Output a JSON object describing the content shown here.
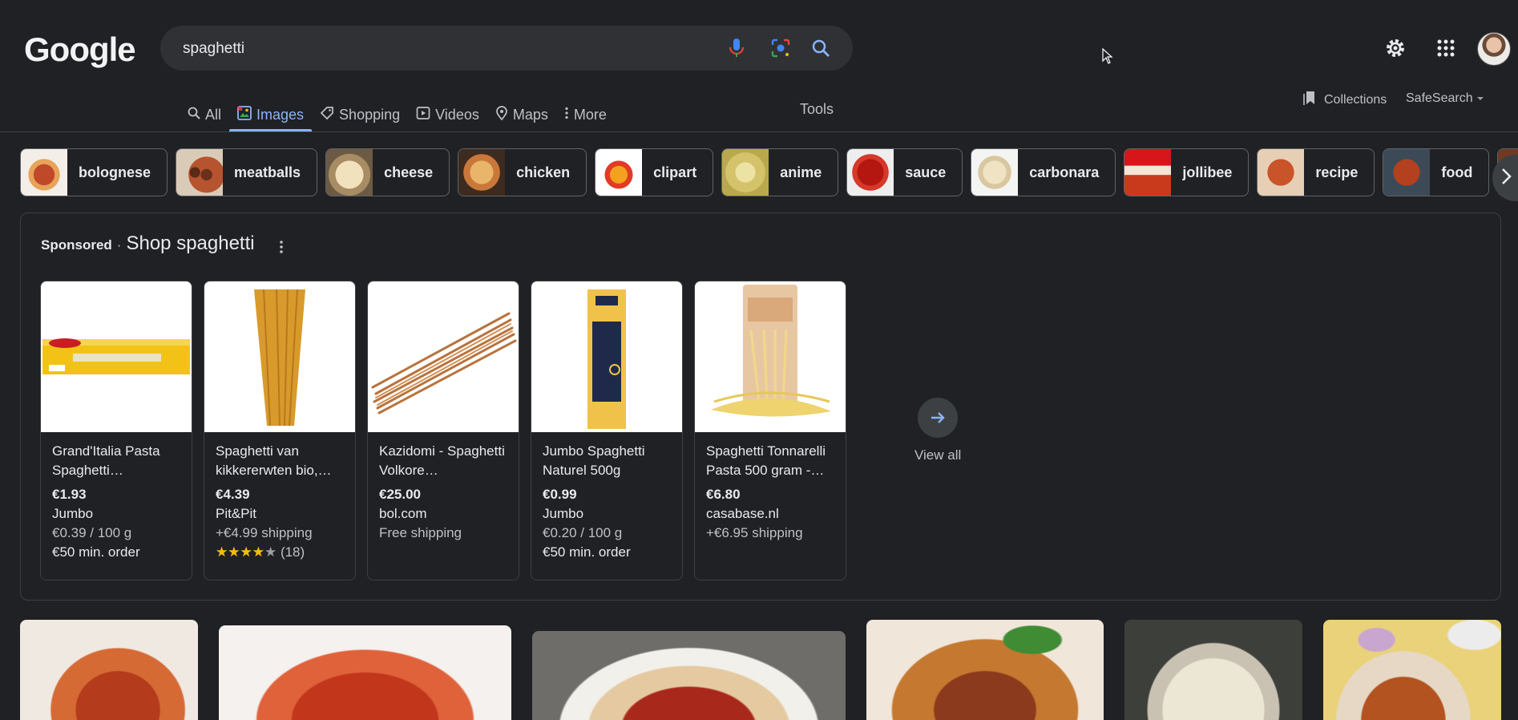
{
  "header": {
    "logo": "Google",
    "search_value": "spaghetti"
  },
  "tabs": [
    {
      "label": "All",
      "icon": "search-icon"
    },
    {
      "label": "Images",
      "icon": "image-icon"
    },
    {
      "label": "Shopping",
      "icon": "tag-icon"
    },
    {
      "label": "Videos",
      "icon": "play-icon"
    },
    {
      "label": "Maps",
      "icon": "pin-icon"
    },
    {
      "label": "More",
      "icon": "kebab-icon"
    }
  ],
  "toolbar": {
    "tools": "Tools",
    "collections": "Collections",
    "safesearch": "SafeSearch"
  },
  "chips": [
    "bolognese",
    "meatballs",
    "cheese",
    "chicken",
    "clipart",
    "anime",
    "sauce",
    "carbonara",
    "jollibee",
    "recipe",
    "food"
  ],
  "shopping": {
    "sponsored": "Sponsored",
    "separator": "·",
    "title": "Shop spaghetti",
    "view_all": "View all",
    "products": [
      {
        "title": "Grand'Italia Pasta Spaghetti…",
        "price": "€1.93",
        "store": "Jumbo",
        "line1": "€0.39 / 100 g",
        "line2": "€50 min. order"
      },
      {
        "title": "Spaghetti van kikkererwten bio,…",
        "price": "€4.39",
        "store": "Pit&Pit",
        "line1": "+€4.99 shipping",
        "rating_stars": "★★★★★",
        "rating_count": "(18)",
        "rating": 4
      },
      {
        "title": "Kazidomi - Spaghetti Volkore…",
        "price": "€25.00",
        "store": "bol.com",
        "line1": "Free shipping"
      },
      {
        "title": "Jumbo Spaghetti Naturel 500g",
        "price": "€0.99",
        "store": "Jumbo",
        "line1": "€0.20 / 100 g",
        "line2": "€50 min. order"
      },
      {
        "title": "Spaghetti Tonnarelli Pasta 500 gram -…",
        "price": "€6.80",
        "store": "casabase.nl",
        "line1": "+€6.95 shipping"
      }
    ]
  },
  "colors": {
    "background": "#202124",
    "accent": "#8ab4f8",
    "star": "#fbbc04"
  }
}
